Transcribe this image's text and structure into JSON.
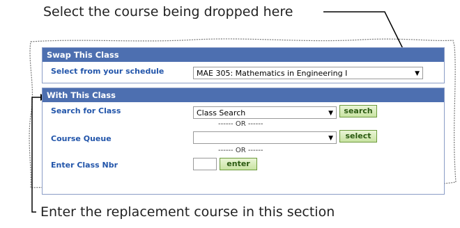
{
  "callouts": {
    "top": "Select the course being dropped here",
    "bottom": "Enter the replacement course in this section"
  },
  "swap": {
    "header": "Swap This Class",
    "label": "Select from your schedule",
    "selected": "MAE 305: Mathematics in Engineering I"
  },
  "with": {
    "header": "With This Class",
    "search_label": "Search for Class",
    "search_select": "Class Search",
    "search_button": "search",
    "or1": "------ OR ------",
    "queue_label": "Course Queue",
    "queue_select": "",
    "select_button": "select",
    "or2": "------ OR ------",
    "nbr_label": "Enter Class Nbr",
    "nbr_value": "",
    "enter_button": "enter"
  },
  "icons": {
    "dropdown": "chevron-down-icon",
    "pointer_top": "arrow-icon",
    "pointer_bottom": "arrow-icon"
  },
  "colors": {
    "header_bg": "#4d6fb0",
    "label_text": "#2255aa",
    "button_bg": "#c8e3a2"
  }
}
